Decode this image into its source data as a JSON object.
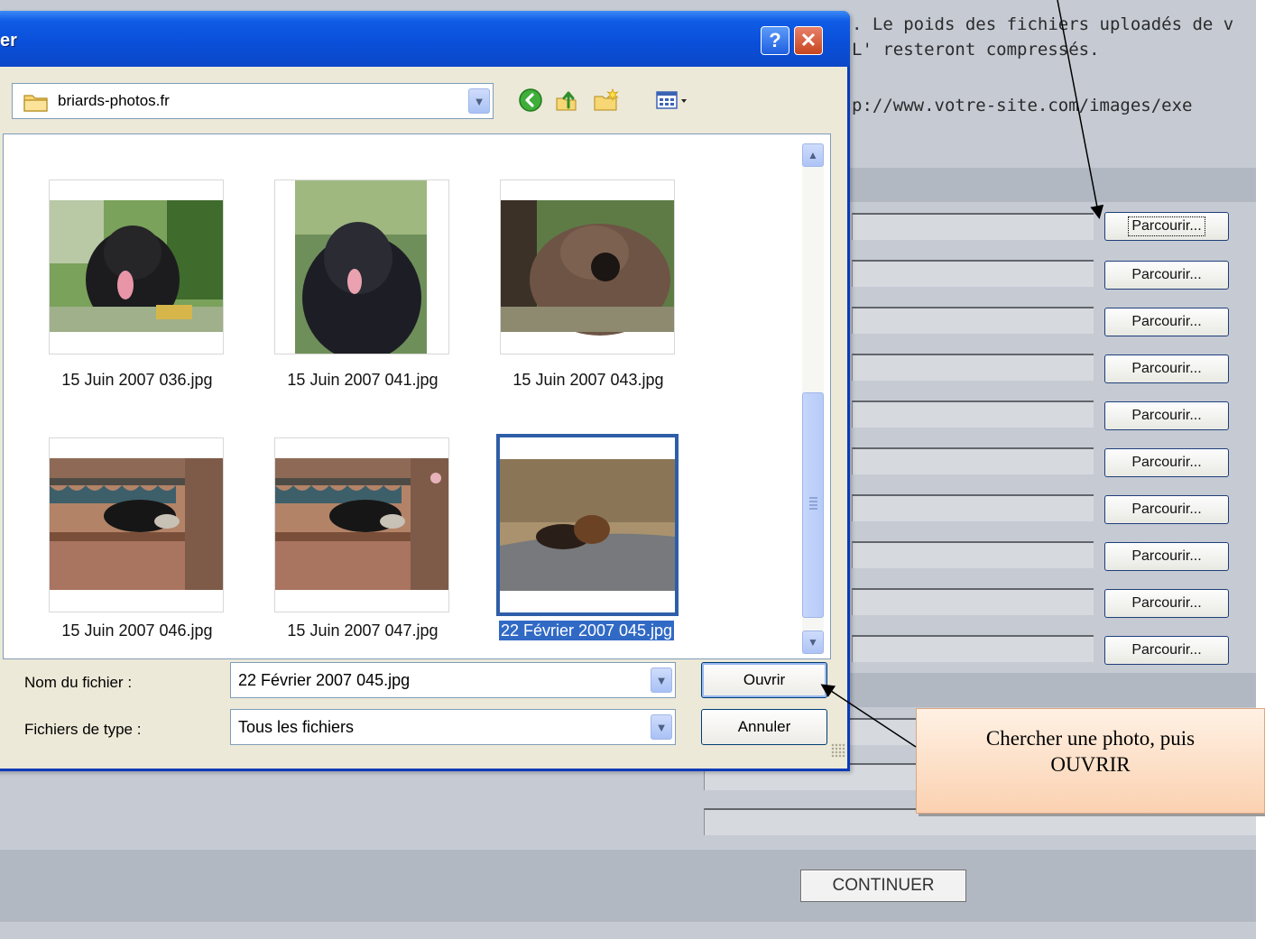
{
  "page": {
    "intro_line1": ". Le poids des fichiers uploadés de v",
    "intro_line2": "L' resteront compressés.",
    "intro_line3": "p://www.votre-site.com/images/exe",
    "browse_buttons": [
      "Parcourir...",
      "Parcourir...",
      "Parcourir...",
      "Parcourir...",
      "Parcourir...",
      "Parcourir...",
      "Parcourir...",
      "Parcourir...",
      "Parcourir...",
      "Parcourir..."
    ],
    "continue_label": "CONTINUER"
  },
  "dialog": {
    "title": "er",
    "help_label": "?",
    "close_label": "✕",
    "look_in_value": "briards-photos.fr",
    "toolbar_icons": [
      "back-icon",
      "up-folder-icon",
      "new-folder-icon",
      "views-menu-icon"
    ],
    "files": [
      {
        "name": "15 Juin 2007 036.jpg",
        "selected": false
      },
      {
        "name": "15 Juin 2007 041.jpg",
        "selected": false
      },
      {
        "name": "15 Juin 2007 043.jpg",
        "selected": false
      },
      {
        "name": "15 Juin 2007 046.jpg",
        "selected": false
      },
      {
        "name": "15 Juin 2007 047.jpg",
        "selected": false
      },
      {
        "name": "22 Février 2007 045.jpg",
        "selected": true
      }
    ],
    "filename_label": "Nom du fichier :",
    "filename_value": "22 Février 2007 045.jpg",
    "filetype_label": "Fichiers de type :",
    "filetype_value": "Tous les fichiers",
    "open_label": "Ouvrir",
    "cancel_label": "Annuler"
  },
  "annotation": {
    "text_line1": "Chercher une photo, puis",
    "text_line2": "OUVRIR"
  },
  "colors": {
    "titlebar": "#0a4ed8",
    "page_background": "#c5cad3",
    "selection": "#316ac5",
    "annotation_fill": "#fbd1b0"
  }
}
